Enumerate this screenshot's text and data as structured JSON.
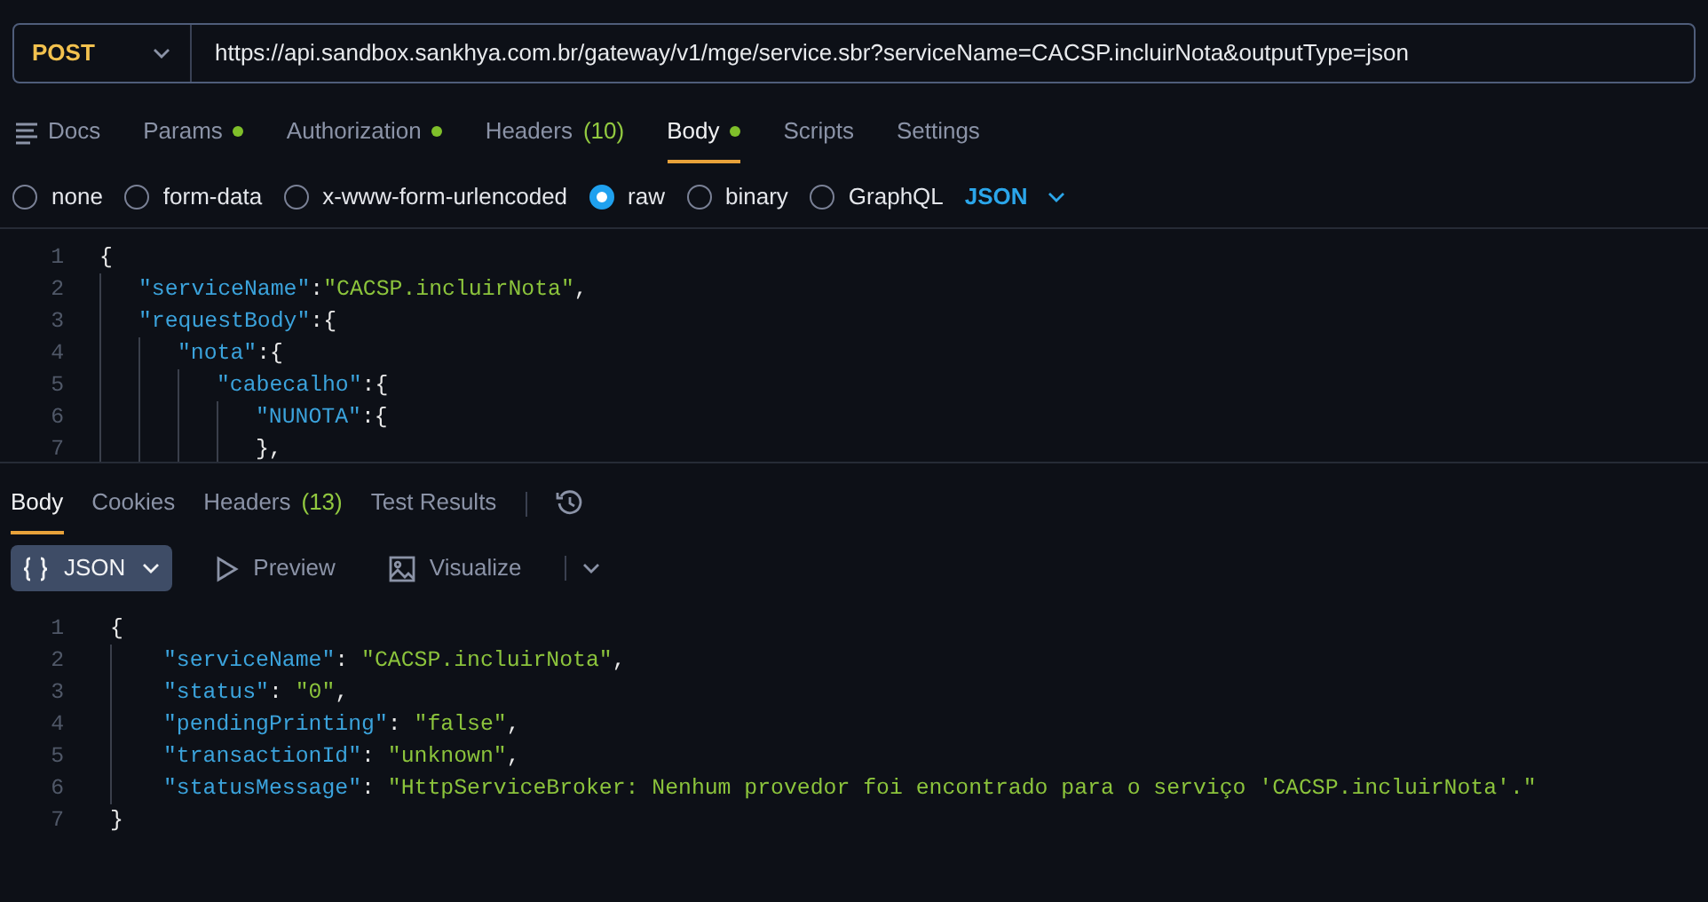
{
  "request_bar": {
    "method": "POST",
    "url": "https://api.sandbox.sankhya.com.br/gateway/v1/mge/service.sbr?serviceName=CACSP.incluirNota&outputType=json"
  },
  "request_tabs": [
    {
      "label": "Docs",
      "kind": "docs",
      "dot": false,
      "selected": false
    },
    {
      "label": "Params",
      "dot": true,
      "selected": false
    },
    {
      "label": "Authorization",
      "dot": true,
      "selected": false
    },
    {
      "label": "Headers",
      "count": "(10)",
      "dot": false,
      "selected": false
    },
    {
      "label": "Body",
      "dot": true,
      "selected": true
    },
    {
      "label": "Scripts",
      "dot": false,
      "selected": false
    },
    {
      "label": "Settings",
      "dot": false,
      "selected": false
    }
  ],
  "body_types": [
    {
      "label": "none",
      "selected": false
    },
    {
      "label": "form-data",
      "selected": false
    },
    {
      "label": "x-www-form-urlencoded",
      "selected": false
    },
    {
      "label": "raw",
      "selected": true
    },
    {
      "label": "binary",
      "selected": false
    },
    {
      "label": "GraphQL",
      "selected": false
    }
  ],
  "raw_format": "JSON",
  "request_code": [
    {
      "number": "1",
      "tokens": [
        {
          "kind": "punct",
          "text": "{"
        }
      ],
      "children": [
        {
          "number": "2",
          "tokens": [
            {
              "kind": "key",
              "text": "\"serviceName\""
            },
            {
              "kind": "punct",
              "text": ":"
            },
            {
              "kind": "string",
              "text": "\"CACSP.incluirNota\""
            },
            {
              "kind": "punct",
              "text": ","
            }
          ]
        },
        {
          "number": "3",
          "tokens": [
            {
              "kind": "key",
              "text": "\"requestBody\""
            },
            {
              "kind": "punct",
              "text": ":{"
            }
          ],
          "children": [
            {
              "number": "4",
              "tokens": [
                {
                  "kind": "key",
                  "text": "\"nota\""
                },
                {
                  "kind": "punct",
                  "text": ":{"
                }
              ],
              "children": [
                {
                  "number": "5",
                  "tokens": [
                    {
                      "kind": "key",
                      "text": "\"cabecalho\""
                    },
                    {
                      "kind": "punct",
                      "text": ":{"
                    }
                  ],
                  "children": [
                    {
                      "number": "6",
                      "tokens": [
                        {
                          "kind": "key",
                          "text": "\"NUNOTA\""
                        },
                        {
                          "kind": "punct",
                          "text": ":{"
                        }
                      ]
                    },
                    {
                      "number": "7",
                      "tokens": [
                        {
                          "kind": "punct",
                          "text": "},"
                        }
                      ]
                    }
                  ]
                }
              ]
            }
          ]
        }
      ]
    }
  ],
  "response_tabs": [
    {
      "label": "Body",
      "selected": true
    },
    {
      "label": "Cookies",
      "selected": false
    },
    {
      "label": "Headers",
      "count": "(13)",
      "selected": false
    },
    {
      "label": "Test Results",
      "selected": false
    }
  ],
  "response_views": [
    {
      "label": "JSON",
      "kind": "json",
      "selected": true
    },
    {
      "label": "Preview",
      "kind": "preview",
      "selected": false
    },
    {
      "label": "Visualize",
      "kind": "visualize",
      "selected": false
    }
  ],
  "response_code": [
    {
      "number": "1",
      "tokens": [
        {
          "kind": "punct",
          "text": "{"
        }
      ],
      "children": [
        {
          "number": "2",
          "tokens": [
            {
              "kind": "key",
              "text": "\"serviceName\""
            },
            {
              "kind": "punct",
              "text": ": "
            },
            {
              "kind": "string",
              "text": "\"CACSP.incluirNota\""
            },
            {
              "kind": "punct",
              "text": ","
            }
          ]
        },
        {
          "number": "3",
          "tokens": [
            {
              "kind": "key",
              "text": "\"status\""
            },
            {
              "kind": "punct",
              "text": ": "
            },
            {
              "kind": "string",
              "text": "\"0\""
            },
            {
              "kind": "punct",
              "text": ","
            }
          ]
        },
        {
          "number": "4",
          "tokens": [
            {
              "kind": "key",
              "text": "\"pendingPrinting\""
            },
            {
              "kind": "punct",
              "text": ": "
            },
            {
              "kind": "string",
              "text": "\"false\""
            },
            {
              "kind": "punct",
              "text": ","
            }
          ]
        },
        {
          "number": "5",
          "tokens": [
            {
              "kind": "key",
              "text": "\"transactionId\""
            },
            {
              "kind": "punct",
              "text": ": "
            },
            {
              "kind": "string",
              "text": "\"unknown\""
            },
            {
              "kind": "punct",
              "text": ","
            }
          ]
        },
        {
          "number": "6",
          "tokens": [
            {
              "kind": "key",
              "text": "\"statusMessage\""
            },
            {
              "kind": "punct",
              "text": ": "
            },
            {
              "kind": "string",
              "text": "\"HttpServiceBroker: Nenhum provedor foi encontrado para o serviço 'CACSP.incluirNota'.\""
            }
          ]
        }
      ]
    },
    {
      "number": "7",
      "tokens": [
        {
          "kind": "punct",
          "text": "}"
        }
      ]
    }
  ]
}
